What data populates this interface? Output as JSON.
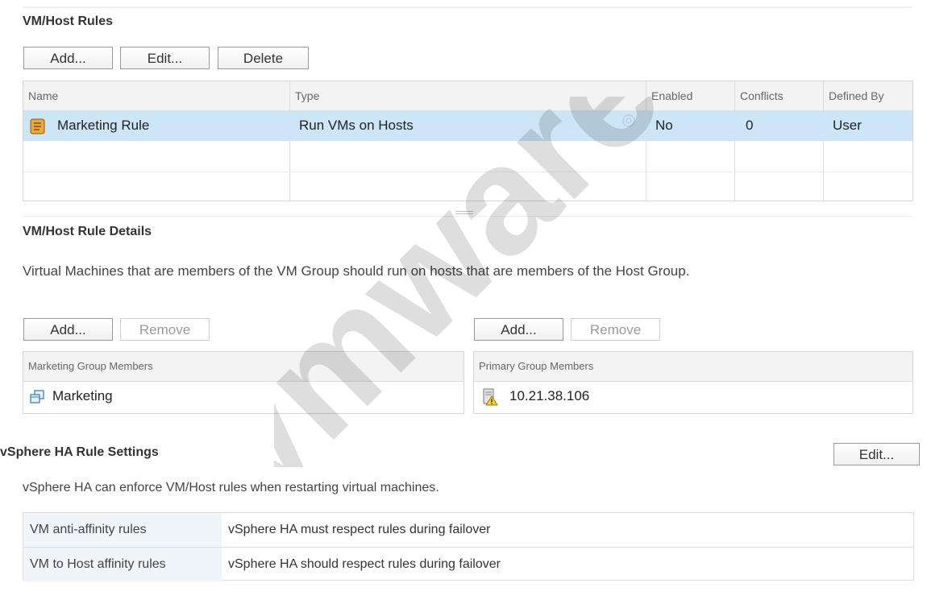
{
  "rules": {
    "title": "VM/Host Rules",
    "buttons": {
      "add": "Add...",
      "edit": "Edit...",
      "delete": "Delete"
    },
    "columns": [
      "Name",
      "Type",
      "Enabled",
      "Conflicts",
      "Defined By"
    ],
    "rows": [
      {
        "name": "Marketing Rule",
        "type": "Run VMs on Hosts",
        "enabled": "No",
        "conflicts": "0",
        "defined_by": "User",
        "icon": "rule-scroll-icon"
      }
    ]
  },
  "details": {
    "title": "VM/Host Rule Details",
    "description": "Virtual Machines that are members of the VM Group should run on hosts that are members of the Host Group.",
    "vm_group": {
      "buttons": {
        "add": "Add...",
        "remove": "Remove"
      },
      "header": "Marketing Group Members",
      "members": [
        {
          "name": "Marketing",
          "icon": "vm-group-icon"
        }
      ]
    },
    "host_group": {
      "buttons": {
        "add": "Add...",
        "remove": "Remove"
      },
      "header": "Primary Group Members",
      "members": [
        {
          "name": "10.21.38.106",
          "icon": "host-warning-icon"
        }
      ]
    }
  },
  "ha": {
    "title": "vSphere HA Rule Settings",
    "edit": "Edit...",
    "description": "vSphere HA can enforce VM/Host rules when restarting virtual machines.",
    "settings": [
      {
        "label": "VM anti-affinity rules",
        "value": "vSphere HA must respect rules during failover"
      },
      {
        "label": "VM to Host affinity rules",
        "value": "vSphere HA should respect rules during failover"
      }
    ]
  },
  "watermark": {
    "text": "vmware"
  },
  "colors": {
    "selected_row": "#cde6f7",
    "header_bg": "#f3f3f3",
    "settings_label_bg": "#f0f5fa"
  }
}
